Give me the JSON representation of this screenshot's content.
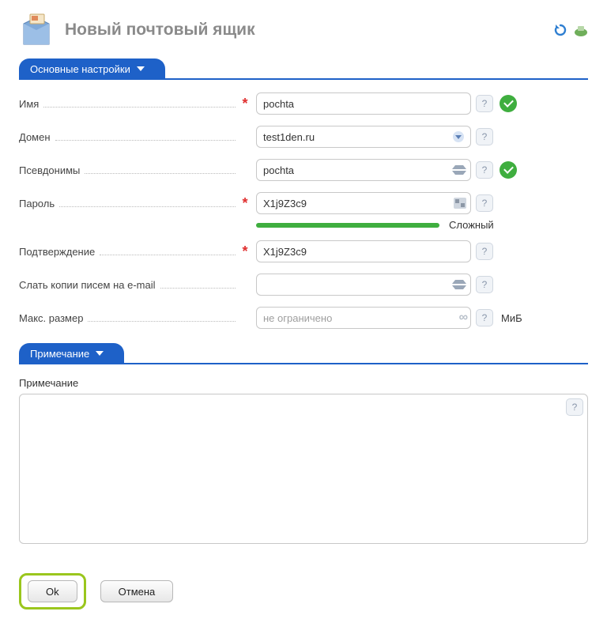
{
  "header": {
    "title": "Новый почтовый ящик"
  },
  "sections": {
    "main": {
      "title": "Основные настройки"
    },
    "note": {
      "title": "Примечание"
    }
  },
  "fields": {
    "name": {
      "label": "Имя",
      "value": "pochta"
    },
    "domain": {
      "label": "Домен",
      "value": "test1den.ru"
    },
    "aliases": {
      "label": "Псевдонимы",
      "value": "pochta"
    },
    "password": {
      "label": "Пароль",
      "value": "X1j9Z3c9",
      "strength_label": "Сложный"
    },
    "confirm": {
      "label": "Подтверждение",
      "value": "X1j9Z3c9"
    },
    "copies": {
      "label": "Слать копии писем на e-mail",
      "value": ""
    },
    "maxsize": {
      "label": "Макс. размер",
      "value": "",
      "placeholder": "не ограничено",
      "unit": "МиБ"
    },
    "note": {
      "label": "Примечание",
      "value": ""
    }
  },
  "buttons": {
    "ok": "Ok",
    "cancel": "Отмена"
  },
  "help_glyph": "?"
}
